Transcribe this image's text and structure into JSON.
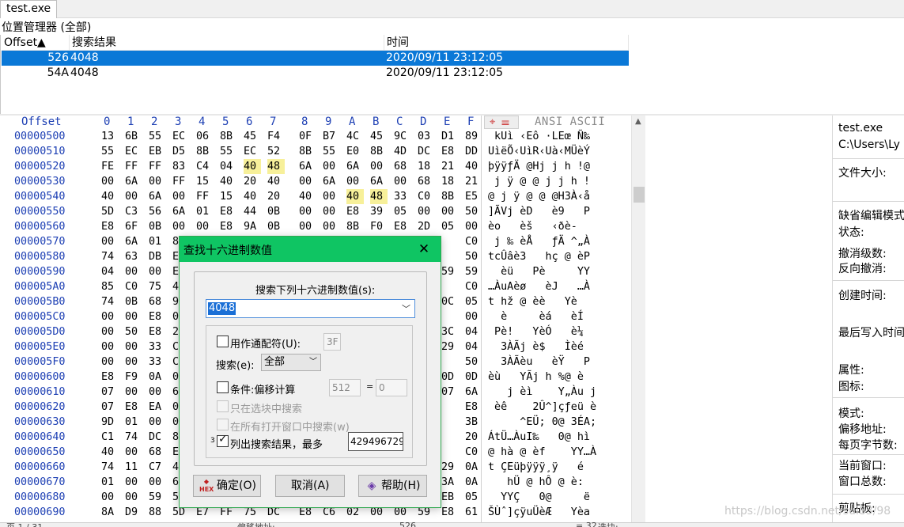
{
  "tab": {
    "label": "test.exe"
  },
  "position_manager": {
    "title": "位置管理器 (全部)",
    "columns": [
      "Offset▲",
      "搜索结果",
      "时间"
    ],
    "rows": [
      {
        "offset": "526",
        "result": "4048",
        "time": "2020/09/11  23:12:05",
        "selected": true
      },
      {
        "offset": "54A",
        "result": "4048",
        "time": "2020/09/11  23:12:05",
        "selected": false
      }
    ]
  },
  "hex": {
    "offset_header": "Offset",
    "col_headers": [
      "0",
      "1",
      "2",
      "3",
      "4",
      "5",
      "6",
      "7",
      "8",
      "9",
      "A",
      "B",
      "C",
      "D",
      "E",
      "F"
    ],
    "ansi_header": "ANSI ASCII",
    "rows": [
      {
        "offset": "00000500",
        "bytes": [
          "13",
          "6B",
          "55",
          "EC",
          "06",
          "8B",
          "45",
          "F4",
          "0F",
          "B7",
          "4C",
          "45",
          "9C",
          "03",
          "D1",
          "89"
        ],
        "ascii": " kUì ‹Eô ·LEœ Ñ‰"
      },
      {
        "offset": "00000510",
        "bytes": [
          "55",
          "EC",
          "EB",
          "D5",
          "8B",
          "55",
          "EC",
          "52",
          "8B",
          "55",
          "E0",
          "8B",
          "4D",
          "DC",
          "E8",
          "DD"
        ],
        "ascii": "UìëÕ‹UìR‹Uà‹MÜèÝ"
      },
      {
        "offset": "00000520",
        "bytes": [
          "FE",
          "FF",
          "FF",
          "83",
          "C4",
          "04",
          "40",
          "48",
          "6A",
          "00",
          "6A",
          "00",
          "68",
          "18",
          "21",
          "40"
        ],
        "ascii": "þÿÿƒÄ @Hj j h !@"
      },
      {
        "offset": "00000530",
        "bytes": [
          "00",
          "6A",
          "00",
          "FF",
          "15",
          "40",
          "20",
          "40",
          "00",
          "6A",
          "00",
          "6A",
          "00",
          "68",
          "18",
          "21"
        ],
        "ascii": " j ÿ @ @ j j h !"
      },
      {
        "offset": "00000540",
        "bytes": [
          "40",
          "00",
          "6A",
          "00",
          "FF",
          "15",
          "40",
          "20",
          "40",
          "00",
          "40",
          "48",
          "33",
          "C0",
          "8B",
          "E5"
        ],
        "ascii": "@ j ÿ @ @ @H3À‹å"
      },
      {
        "offset": "00000550",
        "bytes": [
          "5D",
          "C3",
          "56",
          "6A",
          "01",
          "E8",
          "44",
          "0B",
          "00",
          "00",
          "E8",
          "39",
          "05",
          "00",
          "00",
          "50"
        ],
        "ascii": "]ÃVj èD   è9   P"
      },
      {
        "offset": "00000560",
        "bytes": [
          "E8",
          "6F",
          "0B",
          "00",
          "00",
          "E8",
          "9A",
          "0B",
          "00",
          "00",
          "8B",
          "F0",
          "E8",
          "2D",
          "05",
          "00"
        ],
        "ascii": "èo   èš   ‹ðè-  "
      },
      {
        "offset": "00000570",
        "bytes": [
          "00",
          "6A",
          "01",
          "89",
          "",
          "",
          "",
          "",
          "",
          "",
          "",
          "",
          "",
          "",
          "",
          "C0"
        ],
        "ascii": " j ‰ èÅ   ƒÄ ^„À"
      },
      {
        "offset": "00000580",
        "bytes": [
          "74",
          "63",
          "DB",
          "E2",
          "",
          "",
          "",
          "",
          "",
          "",
          "",
          "",
          "",
          "",
          "",
          "50"
        ],
        "ascii": "tcÛâè3   hç @ èP"
      },
      {
        "offset": "00000590",
        "bytes": [
          "04",
          "00",
          "00",
          "E8",
          "",
          "",
          "",
          "",
          "",
          "",
          "",
          "",
          "",
          "",
          "59",
          "59"
        ],
        "ascii": "  èü   Pè     YY"
      },
      {
        "offset": "000005A0",
        "bytes": [
          "85",
          "C0",
          "75",
          "41",
          "",
          "",
          "",
          "",
          "",
          "",
          "",
          "",
          "",
          "",
          "",
          "C0"
        ],
        "ascii": "…ÀuAèø   èJ   …À"
      },
      {
        "offset": "000005B0",
        "bytes": [
          "74",
          "0B",
          "68",
          "9E",
          "",
          "",
          "",
          "",
          "",
          "",
          "",
          "",
          "",
          "",
          "0C",
          "05"
        ],
        "ascii": "t hž @ èè   Yè  "
      },
      {
        "offset": "000005C0",
        "bytes": [
          "00",
          "00",
          "E8",
          "07",
          "",
          "",
          "",
          "",
          "",
          "",
          "",
          "",
          "",
          "",
          "",
          "00"
        ],
        "ascii": "  è     èá   èÍ  "
      },
      {
        "offset": "000005D0",
        "bytes": [
          "00",
          "50",
          "E8",
          "21",
          "",
          "",
          "",
          "",
          "",
          "",
          "",
          "",
          "",
          "",
          "3C",
          "04"
        ],
        "ascii": " Pè!   YèÓ   è¼  "
      },
      {
        "offset": "000005E0",
        "bytes": [
          "00",
          "00",
          "33",
          "C0",
          "",
          "",
          "",
          "",
          "",
          "",
          "",
          "",
          "",
          "",
          "29",
          "04"
        ],
        "ascii": "  3ÀÃj è$   Ìèé  "
      },
      {
        "offset": "000005F0",
        "bytes": [
          "00",
          "00",
          "33",
          "C0",
          "",
          "",
          "",
          "",
          "",
          "",
          "",
          "",
          "",
          "",
          "",
          "50"
        ],
        "ascii": "  3ÀÃèu   èŸ   P"
      },
      {
        "offset": "00000600",
        "bytes": [
          "E8",
          "F9",
          "0A",
          "00",
          "",
          "",
          "",
          "",
          "",
          "",
          "",
          "",
          "",
          "",
          "0D",
          "0D"
        ],
        "ascii": "èù   YÃj h %@ è "
      },
      {
        "offset": "00000610",
        "bytes": [
          "07",
          "00",
          "00",
          "6A",
          "",
          "",
          "",
          "",
          "",
          "",
          "",
          "",
          "",
          "",
          "07",
          "6A"
        ],
        "ascii": "   j èì    Y„Àu j"
      },
      {
        "offset": "00000620",
        "bytes": [
          "07",
          "E8",
          "EA",
          "04",
          "",
          "",
          "",
          "",
          "",
          "",
          "",
          "",
          "",
          "",
          "",
          "E8"
        ],
        "ascii": " èê    2Û^]çƒeü è"
      },
      {
        "offset": "00000630",
        "bytes": [
          "9D",
          "01",
          "00",
          "00",
          "",
          "",
          "",
          "",
          "",
          "",
          "",
          "",
          "",
          "",
          "",
          "3B"
        ],
        "ascii": "     ^EÜ; 0@ 3ÉA;"
      },
      {
        "offset": "00000640",
        "bytes": [
          "C1",
          "74",
          "DC",
          "85",
          "",
          "",
          "",
          "",
          "",
          "",
          "",
          "",
          "",
          "",
          "",
          "20"
        ],
        "ascii": "ÁtÜ…ÀuI‰   0@ hì "
      },
      {
        "offset": "00000650",
        "bytes": [
          "40",
          "00",
          "68",
          "E0",
          "",
          "",
          "",
          "",
          "",
          "",
          "",
          "",
          "",
          "",
          "",
          "C0"
        ],
        "ascii": "@ hà @ èf    YY…À"
      },
      {
        "offset": "00000660",
        "bytes": [
          "74",
          "11",
          "C7",
          "45",
          "",
          "",
          "",
          "",
          "",
          "",
          "",
          "",
          "",
          "",
          "29",
          "0A"
        ],
        "ascii": "t ÇEüþÿÿÿ¸ÿ   é  "
      },
      {
        "offset": "00000670",
        "bytes": [
          "01",
          "00",
          "00",
          "68",
          "",
          "",
          "",
          "",
          "",
          "",
          "",
          "",
          "",
          "",
          "3A",
          "0A"
        ],
        "ascii": "   hÜ @ hÔ @ è:  "
      },
      {
        "offset": "00000680",
        "bytes": [
          "00",
          "00",
          "59",
          "59",
          "",
          "",
          "",
          "",
          "",
          "",
          "",
          "",
          "",
          "",
          "EB",
          "05"
        ],
        "ascii": "  YYÇ   0@     ë "
      },
      {
        "offset": "00000690",
        "bytes": [
          "8A",
          "D9",
          "88",
          "5D",
          "E7",
          "FF",
          "75",
          "DC",
          "E8",
          "C6",
          "02",
          "00",
          "00",
          "59",
          "E8",
          "61"
        ],
        "ascii": "ŠÙˆ]çÿuÜèÆ   Yèa"
      }
    ],
    "highlights": [
      {
        "row": 2,
        "cols": [
          6,
          7
        ]
      },
      {
        "row": 4,
        "cols": [
          10,
          11
        ]
      }
    ]
  },
  "info_panel": {
    "items": [
      "test.exe",
      "C:\\Users\\Ly",
      "文件大小:",
      "缺省编辑模式",
      "状态:",
      "撤消级数:",
      "反向撤消:",
      "创建时间:",
      "最后写入时间",
      "属性:",
      "图标:",
      "模式:",
      "偏移地址:",
      "每页字节数:",
      "当前窗口:",
      "窗口总数:",
      "剪贴板:"
    ]
  },
  "status_bar": {
    "left": "页 1 / 31",
    "mid": "偏移地址:",
    "mid_val": "526",
    "right_val": "= 32",
    "right_label": "选块:"
  },
  "watermark": "https://blog.csdn.net/sui83/98",
  "dialog": {
    "title": "查找十六进制数值",
    "close_label": "✕",
    "prompt": "搜索下列十六进制数值(s):",
    "search_value": "4048",
    "wildcard_label": "用作通配符(U):",
    "wildcard_value": "3F",
    "search_label": "搜索(e):",
    "search_option": "全部",
    "cond_label": "条件:偏移计算",
    "cond_a": "512",
    "cond_eq": "=",
    "cond_b": "0",
    "only_block_label": "只在选块中搜索",
    "all_windows_label": "在所有打开窗口中搜索(w)",
    "list_results_label": "列出搜索结果，最多",
    "list_prefix": "3",
    "max_value": "429496729",
    "ok_label": "确定(O)",
    "ok_icon_text": "HEX",
    "cancel_label": "取消(A)",
    "help_label": "帮助(H)"
  }
}
